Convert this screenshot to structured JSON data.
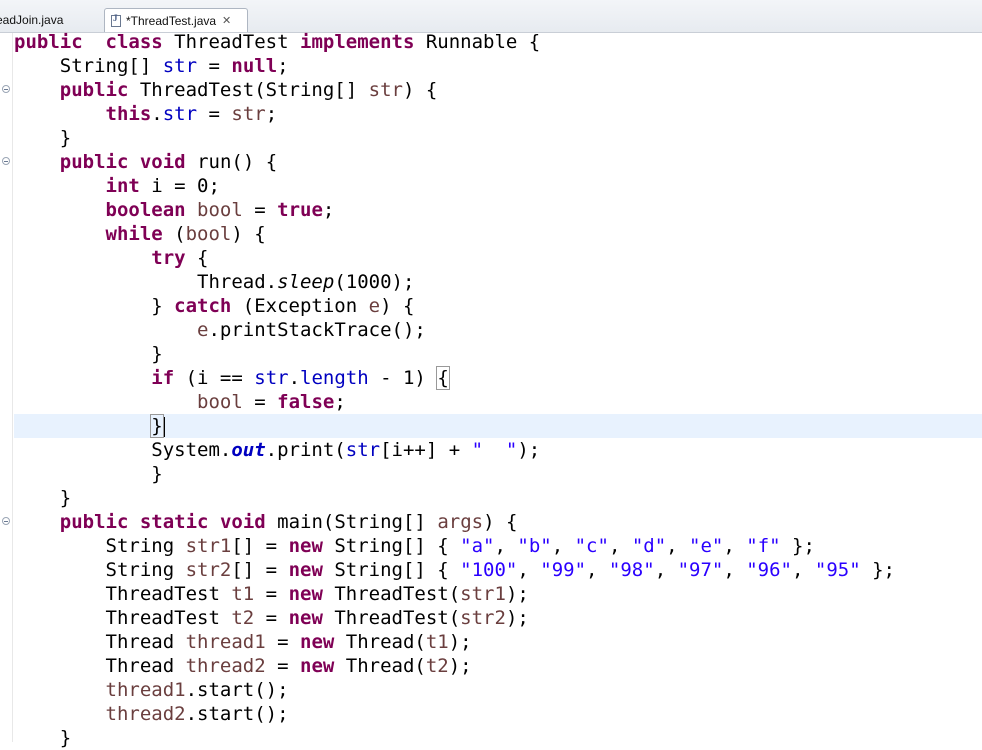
{
  "tabs": [
    {
      "label": "readJoin.java",
      "active": false
    },
    {
      "label": "*ThreadTest.java",
      "active": true
    }
  ],
  "code_lines": [
    [
      [
        "kw",
        "public"
      ],
      [
        "",
        "  "
      ],
      [
        "kw",
        "class"
      ],
      [
        "",
        " ThreadTest "
      ],
      [
        "kw",
        "implements"
      ],
      [
        "",
        " Runnable {"
      ]
    ],
    [
      [
        "",
        "    String[] "
      ],
      [
        "fld",
        "str"
      ],
      [
        "",
        " = "
      ],
      [
        "kw",
        "null"
      ],
      [
        "",
        ";"
      ]
    ],
    [
      [
        "",
        "    "
      ],
      [
        "kw",
        "public"
      ],
      [
        "",
        " ThreadTest(String[] "
      ],
      [
        "var",
        "str"
      ],
      [
        "",
        ") {"
      ]
    ],
    [
      [
        "",
        "        "
      ],
      [
        "kw",
        "this"
      ],
      [
        "",
        "."
      ],
      [
        "fld",
        "str"
      ],
      [
        "",
        " = "
      ],
      [
        "var",
        "str"
      ],
      [
        "",
        ";"
      ]
    ],
    [
      [
        "",
        "    }"
      ]
    ],
    [
      [
        "",
        "    "
      ],
      [
        "kw",
        "public"
      ],
      [
        "",
        " "
      ],
      [
        "kw",
        "void"
      ],
      [
        "",
        " run() {"
      ]
    ],
    [
      [
        "",
        "        "
      ],
      [
        "kw",
        "int"
      ],
      [
        "",
        " i = 0;"
      ]
    ],
    [
      [
        "",
        "        "
      ],
      [
        "kw",
        "boolean"
      ],
      [
        "",
        " "
      ],
      [
        "var",
        "bool"
      ],
      [
        "",
        " = "
      ],
      [
        "kw",
        "true"
      ],
      [
        "",
        ";"
      ]
    ],
    [
      [
        "",
        "        "
      ],
      [
        "kw",
        "while"
      ],
      [
        "",
        " ("
      ],
      [
        "var",
        "bool"
      ],
      [
        "",
        ") {"
      ]
    ],
    [
      [
        "",
        "            "
      ],
      [
        "kw",
        "try"
      ],
      [
        "",
        " {"
      ]
    ],
    [
      [
        "",
        "                Thread."
      ],
      [
        "stm",
        "sleep"
      ],
      [
        "",
        "(1000);"
      ]
    ],
    [
      [
        "",
        "            } "
      ],
      [
        "kw",
        "catch"
      ],
      [
        "",
        " (Exception "
      ],
      [
        "var",
        "e"
      ],
      [
        "",
        ") {"
      ]
    ],
    [
      [
        "",
        "                "
      ],
      [
        "var",
        "e"
      ],
      [
        "",
        ".printStackTrace();"
      ]
    ],
    [
      [
        "",
        "            }"
      ]
    ],
    [
      [
        "",
        "            "
      ],
      [
        "kw",
        "if"
      ],
      [
        "",
        " (i == "
      ],
      [
        "fld",
        "str"
      ],
      [
        "",
        "."
      ],
      [
        "fld",
        "length"
      ],
      [
        "",
        " - 1) "
      ],
      [
        "box",
        "{"
      ]
    ],
    [
      [
        "",
        "                "
      ],
      [
        "var",
        "bool"
      ],
      [
        "",
        " = "
      ],
      [
        "kw",
        "false"
      ],
      [
        "",
        ";"
      ]
    ],
    [
      [
        "",
        "            "
      ],
      [
        "box",
        "}"
      ],
      [
        "caret",
        ""
      ]
    ],
    [
      [
        "",
        "            System."
      ],
      [
        "sfld",
        "out"
      ],
      [
        "",
        ".print("
      ],
      [
        "fld",
        "str"
      ],
      [
        "",
        "[i++] + "
      ],
      [
        "str",
        "\"  \""
      ],
      [
        "",
        ");"
      ]
    ],
    [
      [
        "",
        "            }"
      ]
    ],
    [
      [
        "",
        "    }"
      ]
    ],
    [
      [
        "",
        "    "
      ],
      [
        "kw",
        "public"
      ],
      [
        "",
        " "
      ],
      [
        "kw",
        "static"
      ],
      [
        "",
        " "
      ],
      [
        "kw",
        "void"
      ],
      [
        "",
        " main(String[] "
      ],
      [
        "var",
        "args"
      ],
      [
        "",
        ") {"
      ]
    ],
    [
      [
        "",
        "        String "
      ],
      [
        "var",
        "str1"
      ],
      [
        "",
        "[] = "
      ],
      [
        "kw",
        "new"
      ],
      [
        "",
        " String[] { "
      ],
      [
        "str",
        "\"a\""
      ],
      [
        "",
        ", "
      ],
      [
        "str",
        "\"b\""
      ],
      [
        "",
        ", "
      ],
      [
        "str",
        "\"c\""
      ],
      [
        "",
        ", "
      ],
      [
        "str",
        "\"d\""
      ],
      [
        "",
        ", "
      ],
      [
        "str",
        "\"e\""
      ],
      [
        "",
        ", "
      ],
      [
        "str",
        "\"f\""
      ],
      [
        "",
        " };"
      ]
    ],
    [
      [
        "",
        "        String "
      ],
      [
        "var",
        "str2"
      ],
      [
        "",
        "[] = "
      ],
      [
        "kw",
        "new"
      ],
      [
        "",
        " String[] { "
      ],
      [
        "str",
        "\"100\""
      ],
      [
        "",
        ", "
      ],
      [
        "str",
        "\"99\""
      ],
      [
        "",
        ", "
      ],
      [
        "str",
        "\"98\""
      ],
      [
        "",
        ", "
      ],
      [
        "str",
        "\"97\""
      ],
      [
        "",
        ", "
      ],
      [
        "str",
        "\"96\""
      ],
      [
        "",
        ", "
      ],
      [
        "str",
        "\"95\""
      ],
      [
        "",
        " };"
      ]
    ],
    [
      [
        "",
        "        ThreadTest "
      ],
      [
        "var",
        "t1"
      ],
      [
        "",
        " = "
      ],
      [
        "kw",
        "new"
      ],
      [
        "",
        " ThreadTest("
      ],
      [
        "var",
        "str1"
      ],
      [
        "",
        ");"
      ]
    ],
    [
      [
        "",
        "        ThreadTest "
      ],
      [
        "var",
        "t2"
      ],
      [
        "",
        " = "
      ],
      [
        "kw",
        "new"
      ],
      [
        "",
        " ThreadTest("
      ],
      [
        "var",
        "str2"
      ],
      [
        "",
        ");"
      ]
    ],
    [
      [
        "",
        "        Thread "
      ],
      [
        "var",
        "thread1"
      ],
      [
        "",
        " = "
      ],
      [
        "kw",
        "new"
      ],
      [
        "",
        " Thread("
      ],
      [
        "var",
        "t1"
      ],
      [
        "",
        ");"
      ]
    ],
    [
      [
        "",
        "        Thread "
      ],
      [
        "var",
        "thread2"
      ],
      [
        "",
        " = "
      ],
      [
        "kw",
        "new"
      ],
      [
        "",
        " Thread("
      ],
      [
        "var",
        "t2"
      ],
      [
        "",
        ");"
      ]
    ],
    [
      [
        "",
        "        "
      ],
      [
        "var",
        "thread1"
      ],
      [
        "",
        ".start();"
      ]
    ],
    [
      [
        "",
        "        "
      ],
      [
        "var",
        "thread2"
      ],
      [
        "",
        ".start();"
      ]
    ],
    [
      [
        "",
        "    }"
      ]
    ]
  ]
}
